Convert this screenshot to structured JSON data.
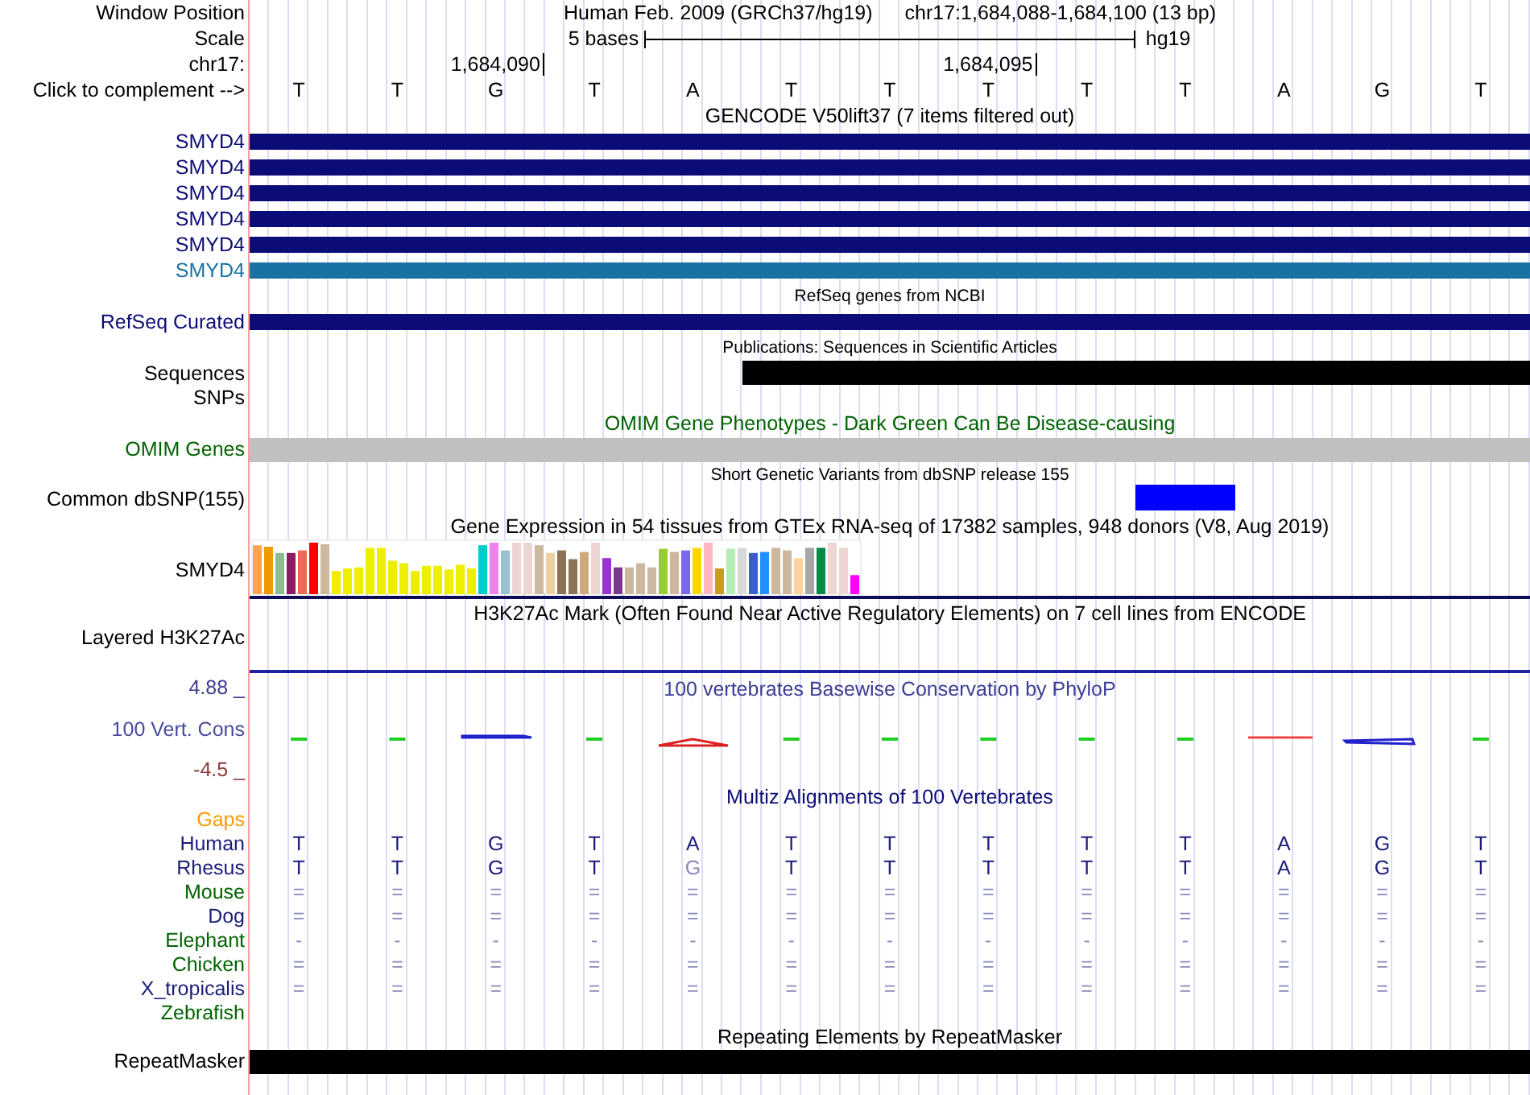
{
  "position_row": {
    "label": "Window Position",
    "assembly": "Human Feb. 2009 (GRCh37/hg19)",
    "range": "chr17:1,684,088-1,684,100 (13 bp)"
  },
  "scale_row": {
    "label": "Scale",
    "span": "5 bases",
    "database": "hg19"
  },
  "ruler_row": {
    "label": "chr17:",
    "ticks": [
      "1,684,090",
      "1,684,095"
    ]
  },
  "bases_row": {
    "label": "Click to complement -->",
    "bases": [
      "T",
      "T",
      "G",
      "T",
      "A",
      "T",
      "T",
      "T",
      "T",
      "T",
      "A",
      "G",
      "T"
    ]
  },
  "tracks": [
    {
      "kind": "genes",
      "title": "GENCODE V50lift37 (7 items filtered out)",
      "color": "#000000",
      "small_title": false,
      "rows": [
        {
          "kind": "gene_bar",
          "label": "SMYD4",
          "color": "#0c0c78"
        },
        {
          "kind": "gene_bar",
          "label": "SMYD4",
          "color": "#0c0c78"
        },
        {
          "kind": "gene_bar",
          "label": "SMYD4",
          "color": "#0c0c78"
        },
        {
          "kind": "gene_bar",
          "label": "SMYD4",
          "color": "#0c0c78"
        },
        {
          "kind": "gene_bar",
          "label": "SMYD4",
          "color": "#0c0c78"
        },
        {
          "kind": "gene_bar",
          "label": "SMYD4",
          "color": "#1a72a4"
        }
      ]
    },
    {
      "kind": "genes",
      "title": "RefSeq genes from NCBI",
      "color": "#000000",
      "small_title": true,
      "rows": [
        {
          "kind": "gene_bar",
          "label": "RefSeq Curated",
          "color": "#0c0c78"
        }
      ]
    },
    {
      "kind": "publications",
      "title": "Publications: Sequences in Scientific Articles",
      "color": "#000000",
      "small_title": true,
      "rows": [
        {
          "kind": "sequences_bar",
          "label": "Sequences",
          "color": "#000000"
        },
        {
          "kind": "empty",
          "label": "SNPs",
          "color": "#000000"
        }
      ]
    },
    {
      "kind": "omim",
      "title": "OMIM Gene Phenotypes - Dark Green Can Be Disease-causing",
      "color": "#006400",
      "small_title": false,
      "rows": [
        {
          "kind": "omim_bar",
          "label": "OMIM Genes",
          "color": "#006400"
        }
      ]
    },
    {
      "kind": "snp",
      "title": "Short Genetic Variants from dbSNP release 155",
      "color": "#000000",
      "small_title": true,
      "rows": [
        {
          "kind": "snp_block",
          "label": "Common dbSNP(155)",
          "color": "#000000"
        }
      ]
    },
    {
      "kind": "expression",
      "title": "Gene Expression in 54 tissues from GTEx RNA-seq of 17382 samples, 948 donors (V8, Aug 2019)",
      "color": "#000000",
      "small_title": false,
      "rows": [
        {
          "kind": "expression_chart",
          "label": "SMYD4",
          "color": "#000000"
        }
      ]
    },
    {
      "kind": "layered",
      "title": "H3K27Ac Mark (Often Found Near Active Regulatory Elements) on 7 cell lines from ENCODE",
      "color": "#000000",
      "small_title": false,
      "rows": [
        {
          "kind": "blank_area",
          "label": "Layered H3K27Ac",
          "color": "#000000"
        }
      ]
    },
    {
      "kind": "conservation",
      "title": "100 vertebrates Basewise Conservation by PhyloP",
      "color": "#3c3c96",
      "small_title": false,
      "max": "4.88 _",
      "label": "100 Vert. Cons",
      "min": "-4.5 _"
    },
    {
      "kind": "alignment",
      "title": "Multiz Alignments of 100 Vertebrates",
      "color": "#0c0c78",
      "small_title": false,
      "rows": [
        {
          "label": "Gaps",
          "color": "#ff9900"
        },
        {
          "label": "Human",
          "color": "#1c1c7c",
          "cells": [
            {
              "text": "T",
              "faded": false
            },
            {
              "text": "T",
              "faded": false
            },
            {
              "text": "G",
              "faded": false
            },
            {
              "text": "T",
              "faded": false
            },
            {
              "text": "A",
              "faded": false
            },
            {
              "text": "T",
              "faded": false
            },
            {
              "text": "T",
              "faded": false
            },
            {
              "text": "T",
              "faded": false
            },
            {
              "text": "T",
              "faded": false
            },
            {
              "text": "T",
              "faded": false
            },
            {
              "text": "A",
              "faded": false
            },
            {
              "text": "G",
              "faded": false
            },
            {
              "text": "T",
              "faded": false
            }
          ]
        },
        {
          "label": "Rhesus",
          "color": "#1c1c7c",
          "cells": [
            {
              "text": "T",
              "faded": false
            },
            {
              "text": "T",
              "faded": false
            },
            {
              "text": "G",
              "faded": false
            },
            {
              "text": "T",
              "faded": false
            },
            {
              "text": "G",
              "faded": true
            },
            {
              "text": "T",
              "faded": false
            },
            {
              "text": "T",
              "faded": false
            },
            {
              "text": "T",
              "faded": false
            },
            {
              "text": "T",
              "faded": false
            },
            {
              "text": "T",
              "faded": false
            },
            {
              "text": "A",
              "faded": false
            },
            {
              "text": "G",
              "faded": false
            },
            {
              "text": "T",
              "faded": false
            }
          ]
        },
        {
          "label": "Mouse",
          "color": "#006400",
          "cells": [
            {
              "text": "=",
              "faded": true
            },
            {
              "text": "=",
              "faded": true
            },
            {
              "text": "=",
              "faded": true
            },
            {
              "text": "=",
              "faded": true
            },
            {
              "text": "=",
              "faded": true
            },
            {
              "text": "=",
              "faded": true
            },
            {
              "text": "=",
              "faded": true
            },
            {
              "text": "=",
              "faded": true
            },
            {
              "text": "=",
              "faded": true
            },
            {
              "text": "=",
              "faded": true
            },
            {
              "text": "=",
              "faded": true
            },
            {
              "text": "=",
              "faded": true
            },
            {
              "text": "=",
              "faded": true
            }
          ]
        },
        {
          "label": "Dog",
          "color": "#1c1c7c",
          "cells": [
            {
              "text": "=",
              "faded": true
            },
            {
              "text": "=",
              "faded": true
            },
            {
              "text": "=",
              "faded": true
            },
            {
              "text": "=",
              "faded": true
            },
            {
              "text": "=",
              "faded": true
            },
            {
              "text": "=",
              "faded": true
            },
            {
              "text": "=",
              "faded": true
            },
            {
              "text": "=",
              "faded": true
            },
            {
              "text": "=",
              "faded": true
            },
            {
              "text": "=",
              "faded": true
            },
            {
              "text": "=",
              "faded": true
            },
            {
              "text": "=",
              "faded": true
            },
            {
              "text": "=",
              "faded": true
            }
          ]
        },
        {
          "label": "Elephant",
          "color": "#006400",
          "cells": [
            {
              "text": "-",
              "faded": true
            },
            {
              "text": "-",
              "faded": true
            },
            {
              "text": "-",
              "faded": true
            },
            {
              "text": "-",
              "faded": true
            },
            {
              "text": "-",
              "faded": true
            },
            {
              "text": "-",
              "faded": true
            },
            {
              "text": "-",
              "faded": true
            },
            {
              "text": "-",
              "faded": true
            },
            {
              "text": "-",
              "faded": true
            },
            {
              "text": "-",
              "faded": true
            },
            {
              "text": "-",
              "faded": true
            },
            {
              "text": "-",
              "faded": true
            },
            {
              "text": "-",
              "faded": true
            }
          ]
        },
        {
          "label": "Chicken",
          "color": "#006400",
          "cells": [
            {
              "text": "=",
              "faded": true
            },
            {
              "text": "=",
              "faded": true
            },
            {
              "text": "=",
              "faded": true
            },
            {
              "text": "=",
              "faded": true
            },
            {
              "text": "=",
              "faded": true
            },
            {
              "text": "=",
              "faded": true
            },
            {
              "text": "=",
              "faded": true
            },
            {
              "text": "=",
              "faded": true
            },
            {
              "text": "=",
              "faded": true
            },
            {
              "text": "=",
              "faded": true
            },
            {
              "text": "=",
              "faded": true
            },
            {
              "text": "=",
              "faded": true
            },
            {
              "text": "=",
              "faded": true
            }
          ]
        },
        {
          "label": "X_tropicalis",
          "color": "#1c1c7c",
          "cells": [
            {
              "text": "=",
              "faded": true
            },
            {
              "text": "=",
              "faded": true
            },
            {
              "text": "=",
              "faded": true
            },
            {
              "text": "=",
              "faded": true
            },
            {
              "text": "=",
              "faded": true
            },
            {
              "text": "=",
              "faded": true
            },
            {
              "text": "=",
              "faded": true
            },
            {
              "text": "=",
              "faded": true
            },
            {
              "text": "=",
              "faded": true
            },
            {
              "text": "=",
              "faded": true
            },
            {
              "text": "=",
              "faded": true
            },
            {
              "text": "=",
              "faded": true
            },
            {
              "text": "=",
              "faded": true
            }
          ]
        },
        {
          "label": "Zebrafish",
          "color": "#006400"
        }
      ]
    },
    {
      "kind": "repeats",
      "title": "Repeating Elements by RepeatMasker",
      "color": "#000000",
      "small_title": false,
      "rows": [
        {
          "kind": "repeat_bar",
          "label": "RepeatMasker",
          "color": "#000000"
        }
      ]
    }
  ]
}
